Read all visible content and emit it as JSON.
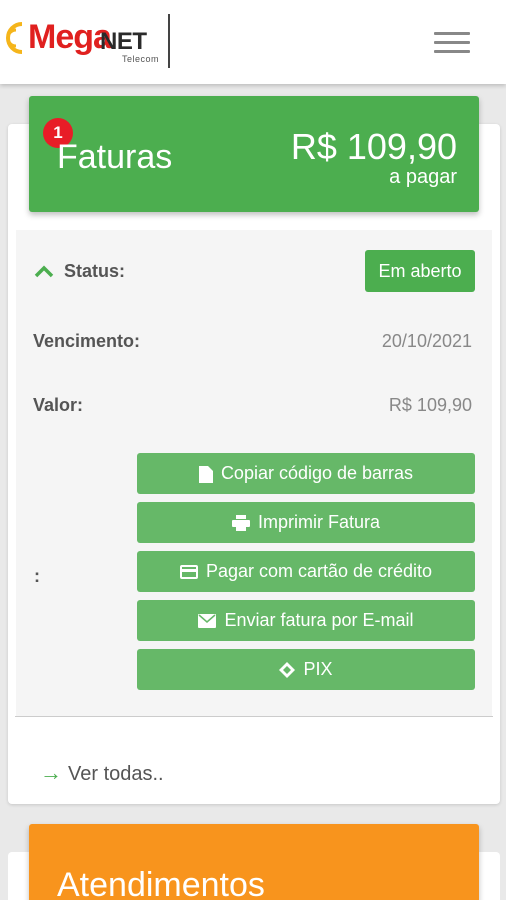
{
  "header": {
    "logo_mega": "Mega",
    "logo_net": "NET",
    "logo_sub": "Telecom",
    "menu_icon": "hamburger-menu-icon"
  },
  "faturas": {
    "badge_count": "1",
    "title": "Faturas",
    "amount": "R$ 109,90",
    "amount_caption": "a pagar",
    "header_color": "#4cae4f"
  },
  "invoice": {
    "status_label": "Status:",
    "status_value": "Em aberto",
    "due_label": "Vencimento:",
    "due_value": "20/10/2021",
    "value_label": "Valor:",
    "value_value": "R$ 109,90",
    "actions_label": ":",
    "actions": [
      {
        "label": "Copiar código de barras",
        "icon": "document-icon"
      },
      {
        "label": "Imprimir Fatura",
        "icon": "printer-icon"
      },
      {
        "label": "Pagar com cartão de crédito",
        "icon": "credit-card-icon"
      },
      {
        "label": "Enviar fatura por E-mail",
        "icon": "envelope-icon"
      },
      {
        "label": "PIX",
        "icon": "pix-icon"
      }
    ]
  },
  "footer_link": {
    "label": "Ver todas..",
    "icon": "arrow-right-icon"
  },
  "atendimentos": {
    "title": "Atendimentos",
    "header_color": "#f8941d"
  }
}
